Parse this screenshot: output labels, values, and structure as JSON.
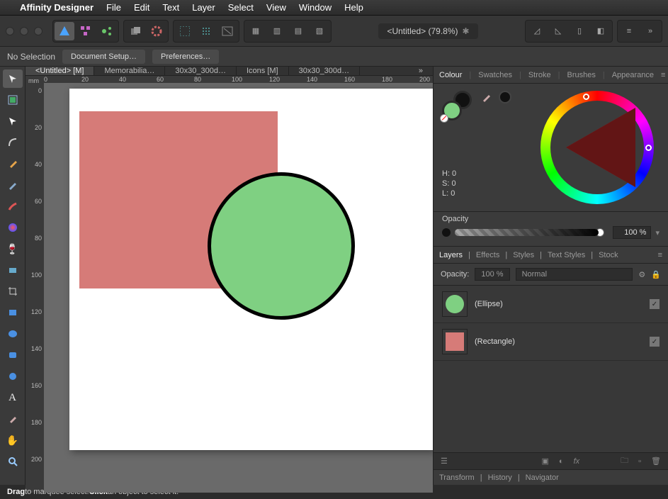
{
  "menubar": {
    "appname": "Affinity Designer",
    "items": [
      "File",
      "Edit",
      "Text",
      "Layer",
      "Select",
      "View",
      "Window",
      "Help"
    ]
  },
  "doc_title": "<Untitled> (79.8%)",
  "contextbar": {
    "selection": "No Selection",
    "btn1": "Document Setup…",
    "btn2": "Preferences…"
  },
  "doctabs": [
    "<Untitled> [M]",
    "Memorabilia…",
    "30x30_300d…",
    "Icons [M]",
    "30x30_300d…"
  ],
  "ruler": {
    "unit": "mm",
    "h": [
      "0",
      "20",
      "40",
      "60",
      "80",
      "100",
      "120",
      "140",
      "160",
      "180",
      "200"
    ],
    "v": [
      "0",
      "20",
      "40",
      "60",
      "80",
      "100",
      "120",
      "140",
      "160",
      "180",
      "200"
    ]
  },
  "colour_panel": {
    "tabs": [
      "Colour",
      "Swatches",
      "Stroke",
      "Brushes",
      "Appearance"
    ],
    "h": "H: 0",
    "s": "S: 0",
    "l": "L: 0",
    "opacity_label": "Opacity",
    "opacity_value": "100 %"
  },
  "layers_panel": {
    "tabs": [
      "Layers",
      "Effects",
      "Styles",
      "Text Styles",
      "Stock"
    ],
    "opacity_label": "Opacity:",
    "opacity_value": "100 %",
    "blend": "Normal",
    "items": [
      {
        "name": "(Ellipse)"
      },
      {
        "name": "(Rectangle)"
      }
    ]
  },
  "bottom_tabs": [
    "Transform",
    "History",
    "Navigator"
  ],
  "status": {
    "drag": "Drag",
    "drag_rest": " to marquee select. ",
    "click": "Click",
    "click_rest": " an object to select it."
  }
}
